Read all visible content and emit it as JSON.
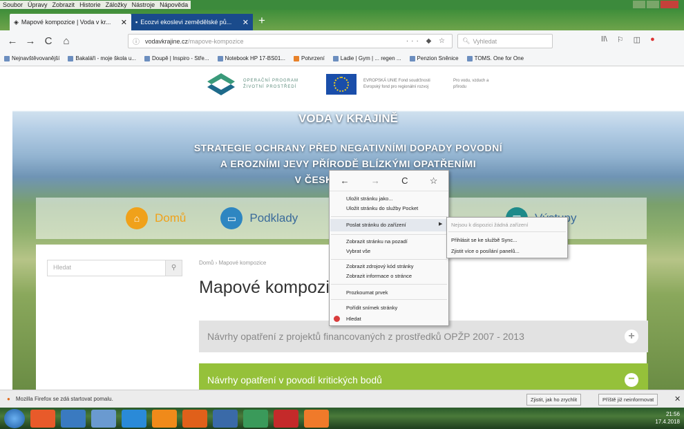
{
  "menubar": {
    "items": [
      "Soubor",
      "Úpravy",
      "Zobrazit",
      "Historie",
      "Záložky",
      "Nástroje",
      "Nápověda"
    ]
  },
  "tabs": [
    {
      "title": "Mapové kompozice | Voda v kr...",
      "close": "✕",
      "state": "active"
    },
    {
      "title": "Ecozvi ekoslevi zemědělské pů...",
      "close": "✕",
      "state": "inactive"
    }
  ],
  "newtab": "+",
  "nav": {
    "back": "←",
    "forward": "→",
    "reload": "C",
    "home": "⌂",
    "info_icon": "ⓘ",
    "url_host": "vodavkrajine.cz",
    "url_path": "/mapove-kompozice",
    "url_actions": "··· ◆ ☆",
    "search_placeholder": "Vyhledat",
    "right_icons": [
      "ǀǀ\\",
      "⚐",
      "◫",
      "●"
    ]
  },
  "bookmarks": [
    "Nejnavštěvovanější",
    "Bakaláři - moje škola u...",
    "Doupě | Inspiro - Stře...",
    "Notebook HP 17-BS01...",
    "Potvrzení",
    "Ladie | Gym | ... regen ...",
    "Penzion Sněnice",
    "TOMS. One for One"
  ],
  "page": {
    "logo_text": "OPERAČNÍ PROGRAM ŽIVOTNÍ PROSTŘEDÍ",
    "eu_text": "EVROPSKÁ UNIE Fond soudržnosti Evropský fond pro regionální rozvoj",
    "eu_text2": "Pro vodu, vzduch a přírodu",
    "hero_title": "VODA V KRAJINĚ",
    "hero_line1": "STRATEGIE OCHRANY PŘED NEGATIVNÍMI DOPADY POVODNÍ",
    "hero_line2": "A EROZNÍMI JEVY PŘÍRODĚ BLÍZKÝMI OPATŘENÍMI",
    "hero_line3": "V ČESKÉ REPUBLICE",
    "nav_home": "Domů",
    "nav_podklady": "Podklady",
    "nav_vystupy": "Výstupy",
    "search_placeholder": "Hledat",
    "breadcrumb": "Domů › Mapové kompozice",
    "title": "Mapové kompozice",
    "accordion1": "Návrhy opatření z projektů financovaných z prostředků OPŽP 2007 - 2013",
    "accordion2": "Návrhy opatření v povodí kritických bodů"
  },
  "context_menu": {
    "items": [
      "Uložit stránku jako...",
      "Uložit stránku do služby Pocket",
      "Poslat stránku do zařízení",
      "Zobrazit stránku na pozadí",
      "Vybrat vše",
      "Zobrazit zdrojový kód stránky",
      "Zobrazit informace o stránce",
      "Prozkoumat prvek",
      "Pořídit snímek stránky",
      "Hledat"
    ],
    "submenu": [
      "Nejsou k dispozici žádná zařízení",
      "Přihlásit se ke službě Sync...",
      "Zjistit více o posílání panelů..."
    ]
  },
  "notification": {
    "text": "Mozilla Firefox se zdá startovat pomalu.",
    "btn1": "Zjistit, jak ho zrychlit",
    "btn2": "Příště již neinformovat",
    "close": "✕"
  },
  "taskbar": {
    "time": "21:56",
    "date": "17.4.2018"
  },
  "colors": {
    "accent_green": "#95c13a",
    "accent_orange": "#f0a11a",
    "active_tab_blue": "#1a4b8c"
  }
}
